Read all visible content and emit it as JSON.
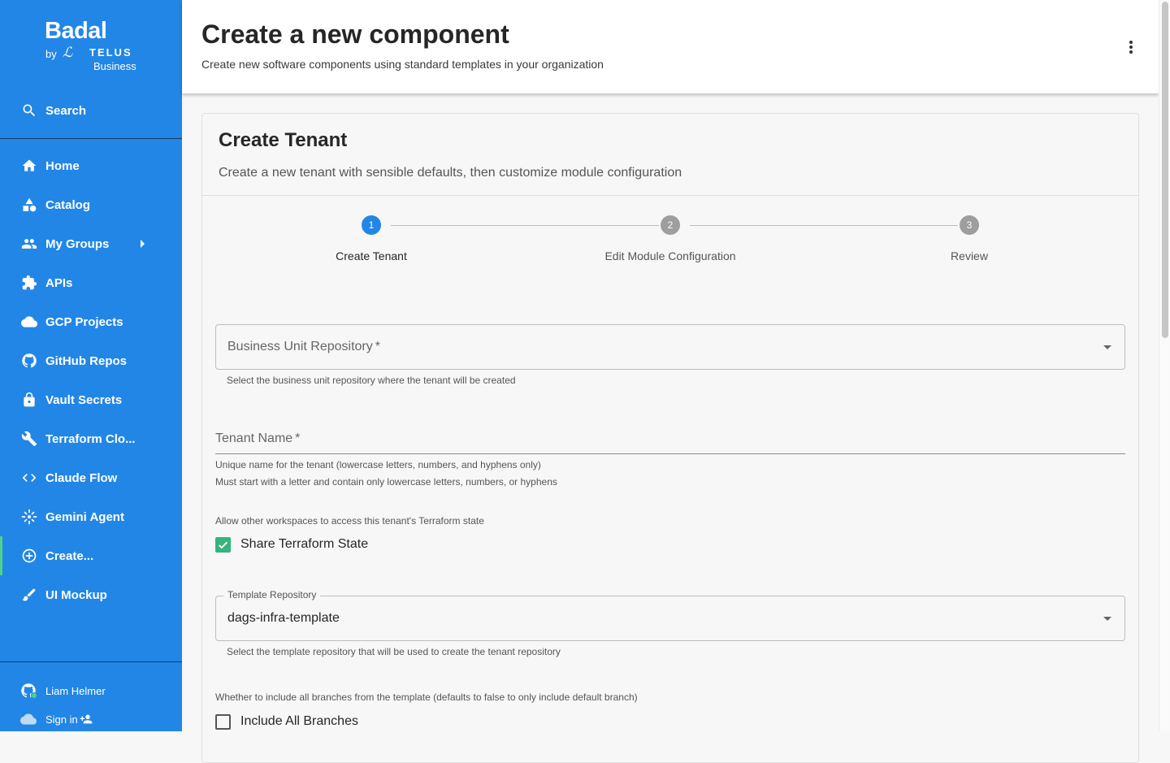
{
  "brand": {
    "name": "Badal",
    "by": "by",
    "partner": "TELUS",
    "division": "Business"
  },
  "sidebar": {
    "search": {
      "label": "Search",
      "icon": "search-icon"
    },
    "items": [
      {
        "label": "Home",
        "icon": "home-icon"
      },
      {
        "label": "Catalog",
        "icon": "catalog-icon"
      },
      {
        "label": "My Groups",
        "icon": "groups-icon"
      },
      {
        "label": "APIs",
        "icon": "puzzle-icon"
      },
      {
        "label": "GCP Projects",
        "icon": "cloud-icon"
      },
      {
        "label": "GitHub Repos",
        "icon": "github-icon"
      },
      {
        "label": "Vault Secrets",
        "icon": "lock-icon"
      },
      {
        "label": "Terraform Clo...",
        "icon": "wrench-icon"
      },
      {
        "label": "Claude Flow",
        "icon": "code-icon"
      },
      {
        "label": "Gemini Agent",
        "icon": "sparkle-icon"
      },
      {
        "label": "Create...",
        "icon": "add-circle-icon",
        "active": true
      },
      {
        "label": "UI Mockup",
        "icon": "brush-icon"
      }
    ],
    "user": {
      "name": "Liam Helmer",
      "icon": "github-icon"
    },
    "signin": {
      "label": "Sign in",
      "icon": "cloud-icon"
    }
  },
  "header": {
    "title": "Create a new component",
    "subtitle": "Create new software components using standard templates in your organization"
  },
  "card": {
    "title": "Create Tenant",
    "description": "Create a new tenant with sensible defaults, then customize module configuration"
  },
  "stepper": [
    {
      "number": "1",
      "label": "Create Tenant",
      "state": "active"
    },
    {
      "number": "2",
      "label": "Edit Module Configuration",
      "state": "pending"
    },
    {
      "number": "3",
      "label": "Review",
      "state": "pending"
    }
  ],
  "form": {
    "business_unit": {
      "label": "Business Unit Repository",
      "required": "*",
      "helper": "Select the business unit repository where the tenant will be created"
    },
    "tenant_name": {
      "label": "Tenant Name",
      "required": "*",
      "helper1": "Unique name for the tenant (lowercase letters, numbers, and hyphens only)",
      "helper2": "Must start with a letter and contain only lowercase letters, numbers, or hyphens"
    },
    "share_state": {
      "description": "Allow other workspaces to access this tenant's Terraform state",
      "label": "Share Terraform State",
      "checked": true
    },
    "template_repo": {
      "legend": "Template Repository",
      "value": "dags-infra-template",
      "helper": "Select the template repository that will be used to create the tenant repository"
    },
    "include_branches": {
      "description": "Whether to include all branches from the template (defaults to false to only include default branch)",
      "label": "Include All Branches",
      "checked": false
    }
  },
  "colors": {
    "sidebar": "#2286e6",
    "active_accent": "#4fd18b",
    "step_active": "#2286e6",
    "step_pending": "#9e9e9e",
    "checkbox": "#36b37e"
  }
}
